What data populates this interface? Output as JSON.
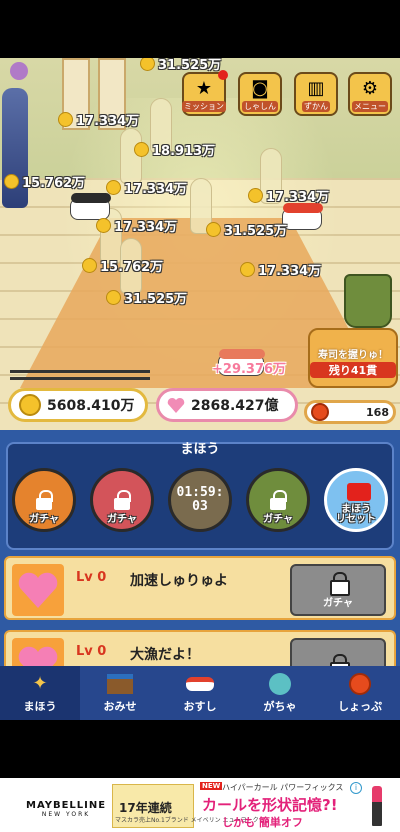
{
  "top_buttons": [
    {
      "label": "ミッション",
      "icon": "medal-icon"
    },
    {
      "label": "しゃしん",
      "icon": "camera-icon"
    },
    {
      "label": "ずかん",
      "icon": "book-icon"
    },
    {
      "label": "メニュー",
      "icon": "gear-icon"
    }
  ],
  "floating_coins": [
    {
      "label": "31.525万"
    },
    {
      "label": "17.334万"
    },
    {
      "label": "18.913万"
    },
    {
      "label": "15.762万"
    },
    {
      "label": "17.334万"
    },
    {
      "label": "17.334万"
    },
    {
      "label": "17.334万"
    },
    {
      "label": "31.525万"
    },
    {
      "label": "15.762万"
    },
    {
      "label": "17.334万"
    },
    {
      "label": "31.525万"
    }
  ],
  "gain_popup": "+29.376万",
  "tub": {
    "line1": "寿司を握りゅ！",
    "line2": "残り41貫"
  },
  "currency": {
    "coins": "5608.410万",
    "hearts": "2868.427億",
    "orbs": "168"
  },
  "magic": {
    "title": "まほう",
    "slots": [
      {
        "label": "ガチャ",
        "locked": true,
        "color": "#e5832d"
      },
      {
        "label": "ガチャ",
        "locked": true,
        "color": "#d3545a"
      },
      {
        "timer_line1": "01:59:",
        "timer_line2": "03",
        "color": "#7a6b4e"
      },
      {
        "label": "ガチャ",
        "locked": true,
        "color": "#6f8d3d"
      },
      {
        "label": "まほう\nリセット",
        "color": "#7ec1f0"
      }
    ]
  },
  "cards": [
    {
      "level": "Lv 0",
      "name": "加速しゅりゅよ",
      "button": "ガチャ"
    },
    {
      "level": "Lv 0",
      "name": "大漁だよ！",
      "button": ""
    }
  ],
  "tabs": [
    {
      "label": "まほう",
      "icon": "sparkle-icon",
      "active": true
    },
    {
      "label": "おみせ",
      "icon": "shop-icon",
      "active": false
    },
    {
      "label": "おすし",
      "icon": "sushi-icon",
      "active": false
    },
    {
      "label": "がちゃ",
      "icon": "capsule-icon",
      "active": false
    },
    {
      "label": "しょっぷ",
      "icon": "orb-icon",
      "active": false
    }
  ],
  "ad": {
    "brand": "MAYBELLINE",
    "brand_sub": "NEW YORK",
    "promo_title": "17年連続",
    "promo_sub": "マスカラ売上No.1ブランド メイベリン ニューヨーク",
    "new_tag": "NEW",
    "copy_line1": "ハイパーカール パワーフィックス",
    "copy_line2": "カールを形状記憶?!",
    "copy_line3": "しかも 簡単オフ"
  },
  "colors": {
    "accent": "#f3c44b",
    "panel": "#2f5aa3",
    "tabbar": "#27478d",
    "pink": "#f18cb6"
  }
}
